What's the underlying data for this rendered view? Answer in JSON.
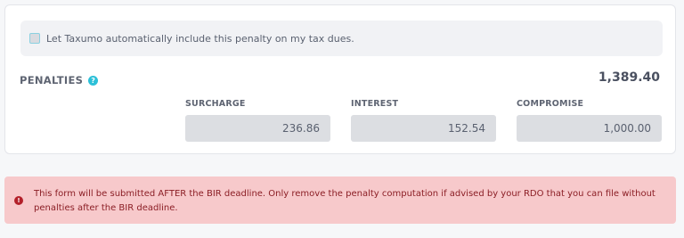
{
  "auto_penalty": {
    "checked": false,
    "label": "Let Taxumo automatically include this penalty on my tax dues."
  },
  "penalties": {
    "title": "PENALTIES",
    "help_icon": "?",
    "total": "1,389.40",
    "fields": [
      {
        "label": "SURCHARGE",
        "value": "236.86"
      },
      {
        "label": "INTEREST",
        "value": "152.54"
      },
      {
        "label": "COMPROMISE",
        "value": "1,000.00"
      }
    ]
  },
  "alert": {
    "icon": "!",
    "message": "This form will be submitted AFTER the BIR deadline. Only remove the penalty computation if advised by your RDO that you can file without penalties after the BIR deadline."
  },
  "colors": {
    "accent": "#2cc0d8",
    "alert_bg": "#f7c9cb",
    "alert_text": "#8b1e25"
  }
}
